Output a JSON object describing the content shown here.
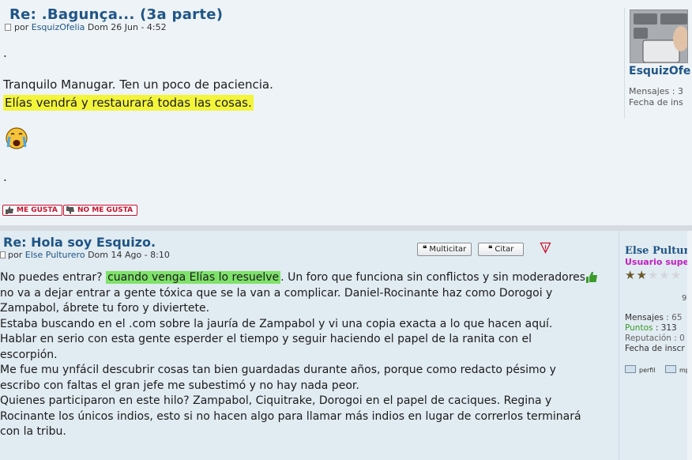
{
  "post1": {
    "title": "Re: .Bagunça... (3a parte)",
    "meta_prefix": "por",
    "author": "EsquizOfelia",
    "date": "Dom 26 Jun - 4:52",
    "dot1": ".",
    "line1": "Tranquilo Manugar. Ten un poco de paciencia.",
    "line2_highlight": "Elías vendrá y restaurará todas las cosas.",
    "dot2": ".",
    "like_label": "ME GUSTA",
    "dislike_label": "NO ME GUSTA",
    "sidebar": {
      "username": "EsquizOfe",
      "messages_label": "Mensajes : 3",
      "joined_label": "Fecha de ins"
    }
  },
  "post2": {
    "title": "Re: Hola soy Esquizo.",
    "meta_prefix": "por",
    "author": "Else Pulturero",
    "date": "Dom 14 Ago - 8:10",
    "multiquote_label": "Multicitar",
    "quote_label": "Citar",
    "para1_before": "No puedes entrar? ",
    "para1_highlight": "cuando venga Elías lo resuelve",
    "para1_after": ". Un foro que funciona sin conflictos y sin moderadores",
    "lines": [
      "no va a dejar entrar a gente tóxica que se la van a complicar. Daniel-Rocinante haz como Dorogoi y",
      "Zampabol, ábrete tu foro y diviertete.",
      "Estaba buscando en el .com sobre la jauría de Zampabol y vi una copia exacta a lo que hacen aquí.",
      "Hablar en serio con esta gente esperder el tiempo y seguir haciendo el papel de la ranita con el",
      "escorpión.",
      "Me fue mu ynfácil descubrir cosas tan bien guardadas durante años, porque como redacto pésimo y",
      "escribo con faltas el gran jefe me subestimó y no hay nada peor.",
      "Quienes participaron en este hilo? Zampabol, Ciquitrake, Dorogoi en el papel de caciques. Regina y",
      "Rocinante los únicos indios, esto si no hacen algo para llamar más indios en lugar de correrlos terminará",
      "con la tribu."
    ],
    "sidebar": {
      "username": "Else Pultur",
      "rank": "Usuario supe",
      "stars_filled": 2,
      "stars_total": 5,
      "digit": "9",
      "messages_label": "Mensajes",
      "messages_value": ": 65",
      "points_label": "Puntos",
      "points_value": ": 313",
      "reputation_label": "Reputación",
      "reputation_value": ": 0",
      "joined_label": "Fecha de inscr",
      "profile_link": "perfil",
      "mp_link": "mp"
    }
  },
  "colors": {
    "title_blue": "#1f5586",
    "highlight_yellow": "#f3f53a",
    "highlight_green": "#7ee26a",
    "like_red": "#c4122f",
    "rank_magenta": "#c020c0"
  }
}
